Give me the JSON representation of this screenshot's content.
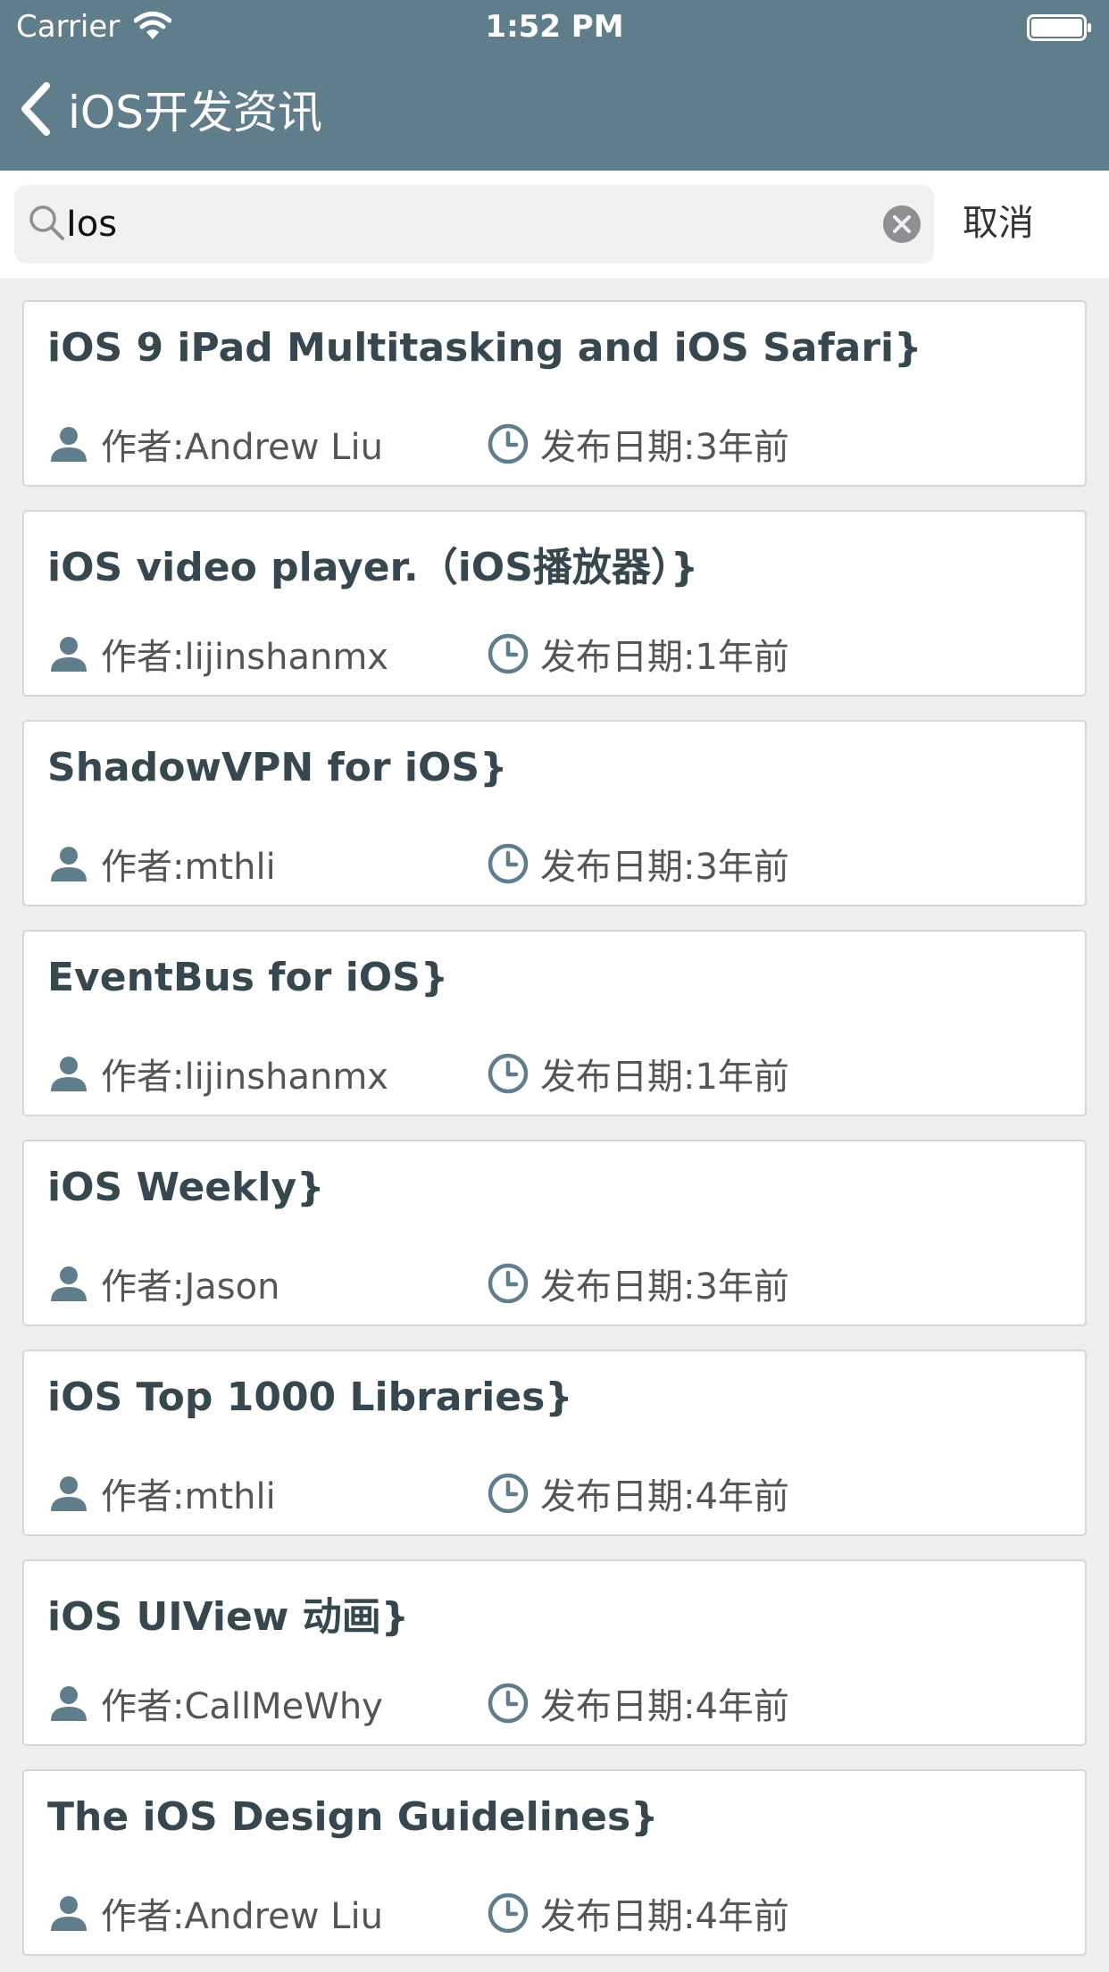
{
  "status_bar": {
    "carrier": "Carrier",
    "time": "1:52 PM"
  },
  "nav": {
    "title": "iOS开发资讯"
  },
  "search": {
    "value": "Ios",
    "cancel_label": "取消"
  },
  "results": [
    {
      "title": "iOS 9 iPad Multitasking and iOS Safari}",
      "author": "作者:Andrew Liu",
      "date": "发布日期:3年前"
    },
    {
      "title": "iOS video player.（iOS播放器）}",
      "author": "作者:lijinshanmx",
      "date": "发布日期:1年前"
    },
    {
      "title": "ShadowVPN for iOS}",
      "author": "作者:mthli",
      "date": "发布日期:3年前"
    },
    {
      "title": "EventBus for iOS}",
      "author": "作者:lijinshanmx",
      "date": "发布日期:1年前"
    },
    {
      "title": "iOS Weekly}",
      "author": "作者:Jason",
      "date": "发布日期:3年前"
    },
    {
      "title": "iOS Top 1000 Libraries}",
      "author": "作者:mthli",
      "date": "发布日期:4年前"
    },
    {
      "title": "iOS UIView 动画}",
      "author": "作者:CallMeWhy",
      "date": "发布日期:4年前"
    },
    {
      "title": "The iOS Design Guidelines}",
      "author": "作者:Andrew Liu",
      "date": "发布日期:4年前"
    }
  ],
  "colors": {
    "header": "#607d8b",
    "title_text": "#37474f",
    "icon": "#607d8b",
    "background": "#efefef"
  },
  "icons": {
    "author": "person-icon",
    "date": "clock-icon",
    "back": "chevron-left-icon",
    "search": "search-icon",
    "clear": "clear-icon"
  }
}
